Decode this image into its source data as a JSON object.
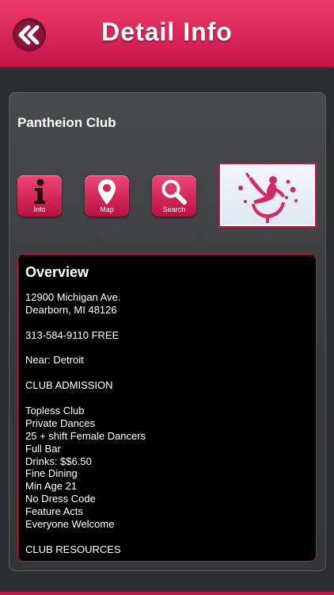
{
  "header": {
    "title": "Detail Info",
    "back_icon": "double-chevron-left-icon"
  },
  "club": {
    "name": "Pantheion Club"
  },
  "toolbar": {
    "info_label": "Info",
    "map_label": "Map",
    "search_label": "Search"
  },
  "overview": {
    "title": "Overview",
    "lines": [
      "12900 Michigan Ave.",
      "Dearborn, MI 48126",
      "",
      "313-584-9110 FREE",
      "",
      "Near: Detroit",
      "",
      "CLUB ADMISSION",
      "",
      "Topless Club",
      "Private Dances",
      "25 + shift Female Dancers",
      "Full Bar",
      "Drinks: $$6.50",
      "Fine Dining",
      "Min Age 21",
      "No Dress Code",
      "Feature Acts",
      "Everyone Welcome",
      "",
      "CLUB RESOURCES"
    ]
  },
  "colors": {
    "accent": "#c8144a",
    "background": "#2c2d30",
    "panel": "#000000"
  }
}
